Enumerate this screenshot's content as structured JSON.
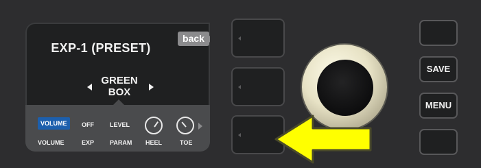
{
  "screen": {
    "title": "EXP-1 (PRESET)",
    "back_label": "back",
    "preset_line1": "GREEN",
    "preset_line2": "BOX",
    "params": [
      {
        "value": "VOLUME",
        "label": "VOLUME",
        "active": true
      },
      {
        "value": "OFF",
        "label": "EXP"
      },
      {
        "value": "LEVEL",
        "label": "PARAM"
      },
      {
        "value": "",
        "label": "HEEL",
        "icon": "knob-icon"
      },
      {
        "value": "",
        "label": "TOE",
        "icon": "knob-icon"
      }
    ]
  },
  "side_buttons": {
    "save_label": "SAVE",
    "menu_label": "MENU"
  },
  "colors": {
    "active_param": "#1c5fad",
    "arrow_fill": "#ffff00"
  }
}
